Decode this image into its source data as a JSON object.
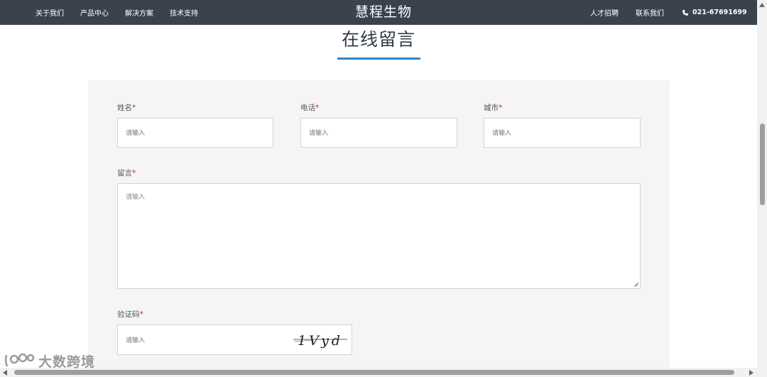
{
  "nav": {
    "left_links": [
      "关于我们",
      "产品中心",
      "解决方案",
      "技术支持"
    ],
    "brand": "慧程生物",
    "right_links": [
      "人才招聘",
      "联系我们"
    ],
    "phone": "021-67691699",
    "phone_icon": "phone-icon"
  },
  "section": {
    "title": "在线留言",
    "underline_color": "#2d88c6"
  },
  "form": {
    "required_mark": "*",
    "name_label": "姓名",
    "name_placeholder": "请输入",
    "phone_label": "电话",
    "phone_placeholder": "请输入",
    "city_label": "城市",
    "city_placeholder": "请输入",
    "message_label": "留言",
    "message_placeholder": "请输入",
    "captcha_label": "验证码",
    "captcha_placeholder": "请输入",
    "captcha_text": "1Vyd"
  },
  "watermark": {
    "text": "大数跨境"
  },
  "colors": {
    "nav_bg": "#39424d",
    "accent": "#2d88c6",
    "required": "#d5232a",
    "panel_bg": "#f5f5f5"
  }
}
